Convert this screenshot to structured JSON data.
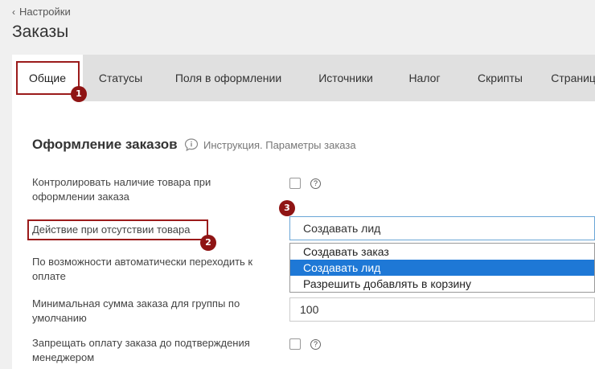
{
  "header": {
    "back_label": "Настройки",
    "title": "Заказы"
  },
  "tabs": [
    {
      "label": "Общие"
    },
    {
      "label": "Статусы"
    },
    {
      "label": "Поля в оформлении"
    },
    {
      "label": "Источники"
    },
    {
      "label": "Налог"
    },
    {
      "label": "Скрипты"
    },
    {
      "label": "Страница"
    }
  ],
  "section": {
    "title": "Оформление заказов",
    "help_link": "Инструкция. Параметры заказа"
  },
  "settings": {
    "stock_control": {
      "label": "Контролировать наличие товара при оформлении заказа",
      "help": "?"
    },
    "out_of_stock_action": {
      "label": "Действие при отсутствии товара",
      "value": "Создавать лид",
      "options": [
        "Создавать заказ",
        "Создавать лид",
        "Разрешить добавлять в корзину"
      ],
      "selected_index": 1
    },
    "auto_payment": {
      "label": "По возможности автоматически переходить к оплате"
    },
    "min_sum_group": {
      "label": "Минимальная сумма заказа для группы по умолчанию",
      "value": "100"
    },
    "block_payment": {
      "label": "Запрещать оплату заказа до подтверждения менеджером",
      "help": "?"
    }
  },
  "annotations": {
    "marker_1": "1",
    "marker_2": "2",
    "marker_3": "3",
    "color": "#8f1414"
  }
}
